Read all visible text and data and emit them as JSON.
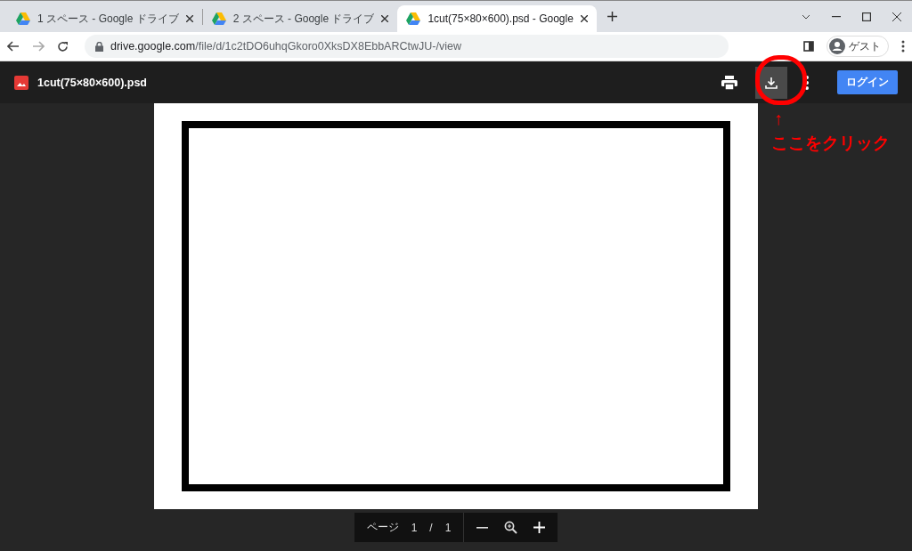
{
  "tabs": [
    {
      "title": "1 スペース - Google ドライブ",
      "selected": false
    },
    {
      "title": "2 スペース - Google ドライブ",
      "selected": false
    },
    {
      "title": "1cut(75×80×600).psd - Google",
      "selected": true
    }
  ],
  "address_bar": {
    "url_host": "drive.google.com",
    "url_path": "/file/d/1c2tDO6uhqGkoro0XksDX8EbbARCtwJU-/view",
    "profile": "ゲスト"
  },
  "viewer": {
    "file_name": "1cut(75×80×600).psd",
    "login_button": "ログイン"
  },
  "annotation": {
    "arrow": "↑",
    "label": "ここをクリック"
  },
  "page_toolbar": {
    "page_label": "ページ",
    "current_page": "1",
    "separator": "/",
    "total_pages": "1"
  }
}
